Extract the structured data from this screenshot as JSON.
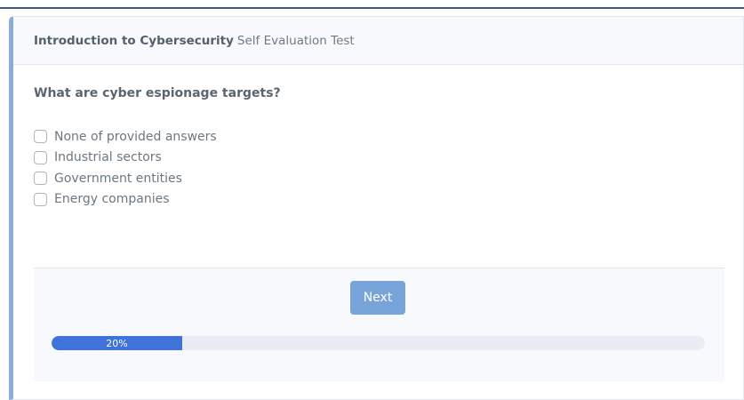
{
  "header": {
    "course": "Introduction to Cybersecurity",
    "subtitle": "Self Evaluation Test"
  },
  "question": {
    "text": "What are cyber espionage targets?",
    "options": [
      "None of provided answers",
      "Industrial sectors",
      "Government entities",
      "Energy companies"
    ]
  },
  "footer": {
    "next_label": "Next",
    "progress_label": "20%",
    "progress_value": 0.2
  },
  "colors": {
    "accent": "#79a4d9",
    "progress_fill": "#3f72da",
    "card_border_left": "#8aaed8"
  }
}
